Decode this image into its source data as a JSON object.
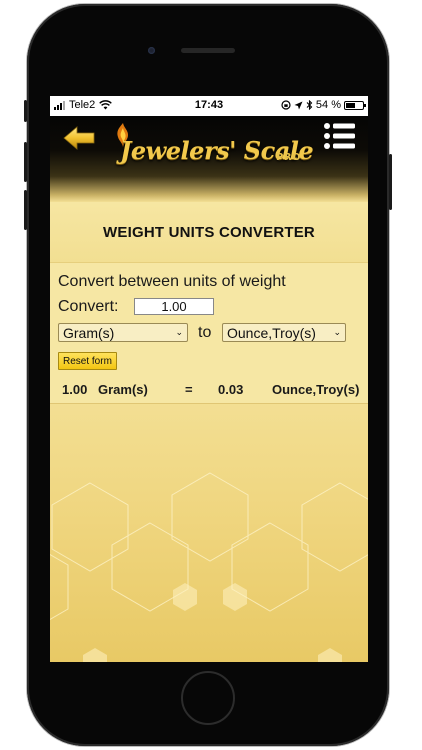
{
  "status_bar": {
    "carrier": "Tele2",
    "time": "17:43",
    "battery_percent": "54 %",
    "battery_level": 0.54
  },
  "header": {
    "back_icon": "arrow-left-icon",
    "menu_icon": "menu-list-icon",
    "logo_text": "Jewelers' Scale",
    "logo_suffix": "PRO"
  },
  "page": {
    "title": "WEIGHT UNITS CONVERTER"
  },
  "converter": {
    "heading": "Convert between units of weight",
    "convert_label": "Convert:",
    "amount_value": "1.00",
    "from_unit": "Gram(s)",
    "to_label": "to",
    "to_unit": "Ounce,Troy(s)",
    "reset_label": "Reset form"
  },
  "result": {
    "input_value": "1.00",
    "input_unit": "Gram(s)",
    "equals": "=",
    "output_value": "0.03",
    "output_unit": "Ounce,Troy(s)"
  },
  "colors": {
    "accent_gold": "#f2c94c",
    "background_cream": "#f6e7a4",
    "header_black": "#050505"
  }
}
